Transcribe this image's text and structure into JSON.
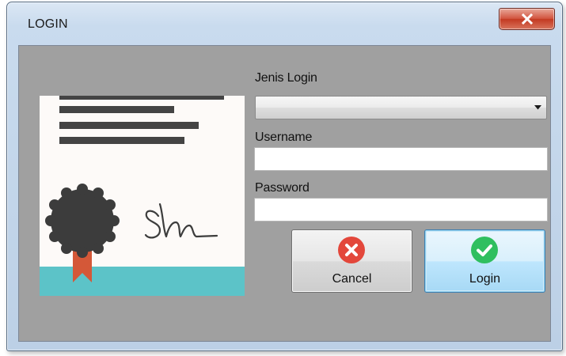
{
  "window": {
    "title": "LOGIN",
    "close_label": "X"
  },
  "form": {
    "login_type_label": "Jenis Login",
    "login_type_value": "",
    "username_label": "Username",
    "username_value": "",
    "password_label": "Password",
    "password_value": ""
  },
  "buttons": {
    "cancel_label": "Cancel",
    "login_label": "Login"
  },
  "icons": {
    "cancel": "close-circle-icon",
    "login": "checkmark-circle-icon",
    "combo_arrow": "chevron-down-icon"
  },
  "colors": {
    "client_background": "#a0a0a0",
    "cancel_icon": "#e3473b",
    "login_icon": "#2fbf5f",
    "certificate_band": "#5cc3c8",
    "ribbon": "#d45838",
    "seal": "#3c3c3c"
  }
}
